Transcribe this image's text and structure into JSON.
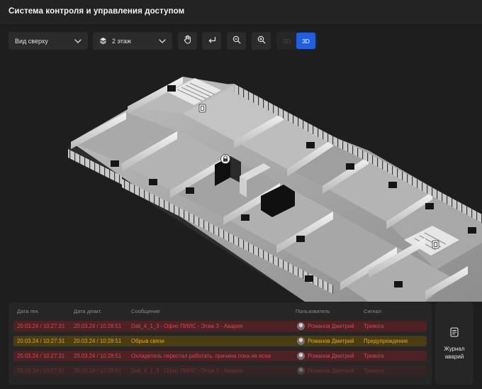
{
  "app": {
    "title": "Система контроля и управления доступом"
  },
  "toolbar": {
    "view_select": {
      "value": "Вид сверху"
    },
    "floor_select": {
      "value": "2 этаж"
    },
    "view_mode": {
      "option_2d": "2D",
      "option_3d": "3D",
      "active": "3D"
    },
    "icons": [
      "hand-pan-icon",
      "undo-icon",
      "zoom-out-icon",
      "zoom-in-icon"
    ]
  },
  "map": {
    "floor": "2 этаж",
    "markers": [
      "door-marker-icon",
      "lock-marker-icon",
      "door-marker-icon"
    ]
  },
  "log": {
    "columns": {
      "date_gen": "Дата ген.",
      "date_deact": "Дата деакт.",
      "message": "Сообщение",
      "user": "Пользователь",
      "signal": "Сигнал"
    },
    "rows": [
      {
        "date_gen": "20.03.24 / 10:27:31",
        "date_deact": "20.03.24 / 10:28:51",
        "message": "Dali_4_1_3 - Офис ПИИС - Этаж 3 - Авария",
        "user": "Романов Дмитрий",
        "signal": "Тревога",
        "level": "alarm"
      },
      {
        "date_gen": "20.03.24 / 10:27:31",
        "date_deact": "20.03.24 / 10:28:51",
        "message": "Обрыв связи",
        "user": "Романов Дмитрий",
        "signal": "Предупреждение",
        "level": "warn"
      },
      {
        "date_gen": "20.03.24 / 10:27:31",
        "date_deact": "20.03.24 / 10:28:51",
        "message": "Охладитель перестал работать, причина пока не ясна",
        "user": "Романов Дмитрий",
        "signal": "Тревога",
        "level": "alarm"
      },
      {
        "date_gen": "20.03.24 / 10:27:31",
        "date_deact": "20.03.24 / 10:28:51",
        "message": "Dali_4_1_3 - Офис ПИИС - Этаж 3 - Авария",
        "user": "Романов Дмитрий",
        "signal": "Тревога",
        "level": "alarm"
      }
    ],
    "colors": {
      "alarm_bg": "#4e2125",
      "alarm_text": "#cf4a52",
      "warn_bg": "#4b3d12",
      "warn_text": "#d9a629"
    }
  },
  "journal": {
    "label": "Журнал аварий",
    "icon": "journal-doc-icon"
  },
  "colors": {
    "background": "#1e1e1e",
    "panel": "#262626",
    "accent": "#1f5fe0"
  }
}
